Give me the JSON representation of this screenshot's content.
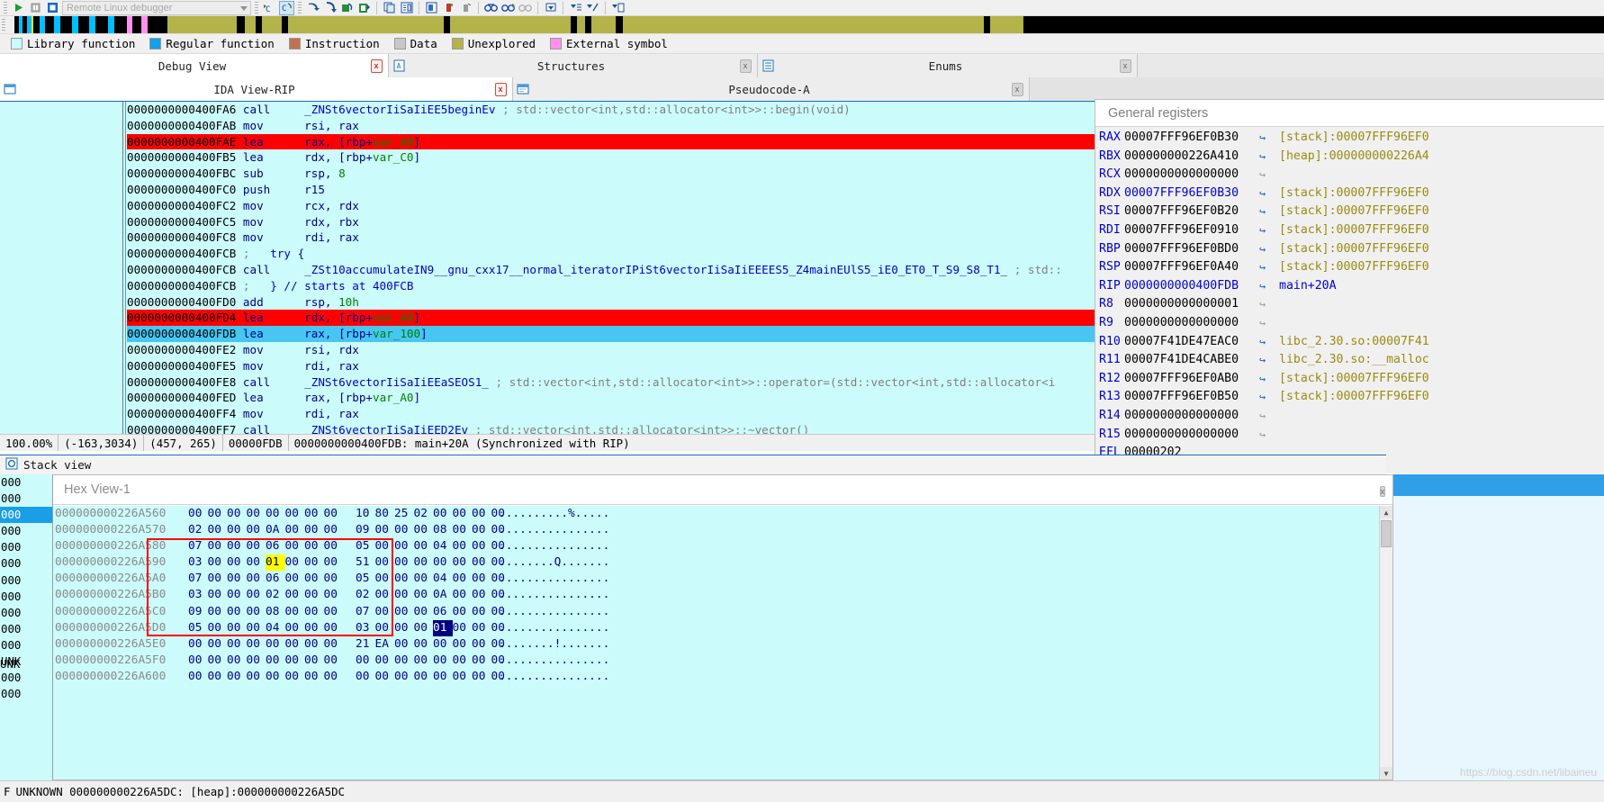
{
  "toolbar": {
    "debugger_combo_value": "Remote Linux debugger",
    "icons": [
      "run-icon",
      "pause-icon",
      "stop-icon",
      "combo-dropdown-icon",
      "step-into-c-icon",
      "step-over-c-icon",
      "run-to-cursor-icon",
      "step-into-icon",
      "step-over-icon",
      "run-until-return-icon",
      "jump-icon",
      "copy-icon",
      "breakpoints-icon",
      "func-list-icon",
      "stack-trace-icon",
      "thread-icon",
      "watch-icon",
      "binocular-icon",
      "binocular-next-icon",
      "binocular-prev-icon",
      "down-arrow-icon",
      "down-list-icon",
      "down-pen-icon",
      "down-code-icon"
    ]
  },
  "legend": {
    "items": [
      {
        "label": "Library function",
        "color": "#c9fdfd"
      },
      {
        "label": "Regular function",
        "color": "#0fa2e8"
      },
      {
        "label": "Instruction",
        "color": "#c0714f"
      },
      {
        "label": "Data",
        "color": "#c8c8c8"
      },
      {
        "label": "Unexplored",
        "color": "#b3b34a"
      },
      {
        "label": "External symbol",
        "color": "#ff90f0"
      }
    ]
  },
  "tabs_row1": [
    {
      "label": "Debug View",
      "icon": "",
      "active": true,
      "close": "x",
      "close_style": "red"
    },
    {
      "label": "Structures",
      "icon": "struct-icon",
      "active": false,
      "close": "x",
      "close_style": "grey"
    },
    {
      "label": "Enums",
      "icon": "enums-icon",
      "active": false,
      "close": "x",
      "close_style": "grey"
    }
  ],
  "tabs_row2": [
    {
      "label": "IDA View-RIP",
      "icon": "view-icon",
      "active": true,
      "close": "x",
      "close_style": "red"
    },
    {
      "label": "Pseudocode-A",
      "icon": "pseudo-icon",
      "active": false,
      "close": "x",
      "close_style": "grey"
    }
  ],
  "disassembly": {
    "lines": [
      {
        "addr": "0000000000400FA6",
        "mnem": "call",
        "op": "_ZNSt6vectorIiSaIiEE5beginEv",
        "opclass": "name",
        "cmt": "; std::vector<int,std::allocator<int>>::begin(void)",
        "hl": "none"
      },
      {
        "addr": "0000000000400FAB",
        "mnem": "mov",
        "op": "rsi, rax",
        "opclass": "op",
        "cmt": "",
        "hl": "none"
      },
      {
        "addr": "0000000000400FAE",
        "mnem": "lea",
        "op": "rax, [rbp+var_A0]",
        "opclass": "var",
        "cmt": "",
        "hl": "red"
      },
      {
        "addr": "0000000000400FB5",
        "mnem": "lea",
        "op": "rdx, [rbp+var_C0]",
        "opclass": "var",
        "cmt": "",
        "hl": "none"
      },
      {
        "addr": "0000000000400FBC",
        "mnem": "sub",
        "op": "rsp, 8",
        "opclass": "num",
        "cmt": "",
        "hl": "none"
      },
      {
        "addr": "0000000000400FC0",
        "mnem": "push",
        "op": "r15",
        "opclass": "op",
        "cmt": "",
        "hl": "none"
      },
      {
        "addr": "0000000000400FC2",
        "mnem": "mov",
        "op": "rcx, rdx",
        "opclass": "op",
        "cmt": "",
        "hl": "none"
      },
      {
        "addr": "0000000000400FC5",
        "mnem": "mov",
        "op": "rdx, rbx",
        "opclass": "op",
        "cmt": "",
        "hl": "none"
      },
      {
        "addr": "0000000000400FC8",
        "mnem": "mov",
        "op": "rdi, rax",
        "opclass": "op",
        "cmt": "",
        "hl": "none"
      },
      {
        "addr": "0000000000400FCB",
        "mnem": ";",
        "op": "try {",
        "opclass": "trycmt",
        "cmt": "",
        "hl": "none"
      },
      {
        "addr": "0000000000400FCB",
        "mnem": "call",
        "op": "_ZSt10accumulateIN9__gnu_cxx17__normal_iteratorIPiSt6vectorIiSaIiEEEES5_Z4mainEUlS5_iE0_ET0_T_S9_S8_T1_",
        "opclass": "name",
        "cmt": "; std::",
        "hl": "none"
      },
      {
        "addr": "0000000000400FCB",
        "mnem": ";",
        "op": "} // starts at 400FCB",
        "opclass": "trycmt",
        "cmt": "",
        "hl": "none"
      },
      {
        "addr": "0000000000400FD0",
        "mnem": "add",
        "op": "rsp, 10h",
        "opclass": "num",
        "cmt": "",
        "hl": "none"
      },
      {
        "addr": "0000000000400FD4",
        "mnem": "lea",
        "op": "rdx, [rbp+var_A0]",
        "opclass": "var",
        "cmt": "",
        "hl": "red"
      },
      {
        "addr": "0000000000400FDB",
        "mnem": "lea",
        "op": "rax, [rbp+var_100]",
        "opclass": "var",
        "cmt": "",
        "hl": "blue"
      },
      {
        "addr": "0000000000400FE2",
        "mnem": "mov",
        "op": "rsi, rdx",
        "opclass": "op",
        "cmt": "",
        "hl": "none"
      },
      {
        "addr": "0000000000400FE5",
        "mnem": "mov",
        "op": "rdi, rax",
        "opclass": "op",
        "cmt": "",
        "hl": "none"
      },
      {
        "addr": "0000000000400FE8",
        "mnem": "call",
        "op": "_ZNSt6vectorIiSaIiEEaSEOS1_",
        "opclass": "name",
        "cmt": "; std::vector<int,std::allocator<int>>::operator=(std::vector<int,std::allocator<i",
        "hl": "none"
      },
      {
        "addr": "0000000000400FED",
        "mnem": "lea",
        "op": "rax, [rbp+var_A0]",
        "opclass": "var",
        "cmt": "",
        "hl": "none"
      },
      {
        "addr": "0000000000400FF4",
        "mnem": "mov",
        "op": "rdi, rax",
        "opclass": "op",
        "cmt": "",
        "hl": "none"
      },
      {
        "addr": "0000000000400FF7",
        "mnem": "call",
        "op": "_ZNSt6vectorIiSaIiEED2Ev",
        "opclass": "name",
        "cmt": "; std::vector<int,std::allocator<int>>::~vector()",
        "hl": "none"
      }
    ],
    "status": [
      "100.00%",
      "(-163,3034)",
      "(457, 265)",
      "00000FDB",
      "0000000000400FDB: main+20A (Synchronized with RIP)"
    ]
  },
  "registers": {
    "title": "General registers",
    "rows": [
      {
        "name": "RAX",
        "value": "00007FFF96EF0B30",
        "value_blue": false,
        "arrow": "active",
        "comment": "[stack]:00007FFF96EF0",
        "comment_blue": false
      },
      {
        "name": "RBX",
        "value": "000000000226A410",
        "value_blue": false,
        "arrow": "active",
        "comment": "[heap]:000000000226A4",
        "comment_blue": false
      },
      {
        "name": "RCX",
        "value": "0000000000000000",
        "value_blue": false,
        "arrow": "grey",
        "comment": "",
        "comment_blue": false
      },
      {
        "name": "RDX",
        "value": "00007FFF96EF0B30",
        "value_blue": true,
        "arrow": "active",
        "comment": "[stack]:00007FFF96EF0",
        "comment_blue": false
      },
      {
        "name": "RSI",
        "value": "00007FFF96EF0B20",
        "value_blue": false,
        "arrow": "active",
        "comment": "[stack]:00007FFF96EF0",
        "comment_blue": false
      },
      {
        "name": "RDI",
        "value": "00007FFF96EF0910",
        "value_blue": false,
        "arrow": "active",
        "comment": "[stack]:00007FFF96EF0",
        "comment_blue": false
      },
      {
        "name": "RBP",
        "value": "00007FFF96EF0BD0",
        "value_blue": false,
        "arrow": "active",
        "comment": "[stack]:00007FFF96EF0",
        "comment_blue": false
      },
      {
        "name": "RSP",
        "value": "00007FFF96EF0A40",
        "value_blue": false,
        "arrow": "active",
        "comment": "[stack]:00007FFF96EF0",
        "comment_blue": false
      },
      {
        "name": "RIP",
        "value": "0000000000400FDB",
        "value_blue": true,
        "arrow": "active",
        "comment": "main+20A",
        "comment_blue": true
      },
      {
        "name": "R8",
        "value": "0000000000000001",
        "value_blue": false,
        "arrow": "grey",
        "comment": "",
        "comment_blue": false
      },
      {
        "name": "R9",
        "value": "0000000000000000",
        "value_blue": false,
        "arrow": "grey",
        "comment": "",
        "comment_blue": false
      },
      {
        "name": "R10",
        "value": "00007F41DE47EAC0",
        "value_blue": false,
        "arrow": "active",
        "comment": "libc_2.30.so:00007F41",
        "comment_blue": false
      },
      {
        "name": "R11",
        "value": "00007F41DE4CABE0",
        "value_blue": false,
        "arrow": "active",
        "comment": "libc_2.30.so:__malloc",
        "comment_blue": false
      },
      {
        "name": "R12",
        "value": "00007FFF96EF0AB0",
        "value_blue": false,
        "arrow": "active",
        "comment": "[stack]:00007FFF96EF0",
        "comment_blue": false
      },
      {
        "name": "R13",
        "value": "00007FFF96EF0B50",
        "value_blue": false,
        "arrow": "active",
        "comment": "[stack]:00007FFF96EF0",
        "comment_blue": false
      },
      {
        "name": "R14",
        "value": "0000000000000000",
        "value_blue": false,
        "arrow": "grey",
        "comment": "",
        "comment_blue": false
      },
      {
        "name": "R15",
        "value": "0000000000000000",
        "value_blue": false,
        "arrow": "grey",
        "comment": "",
        "comment_blue": false
      },
      {
        "name": "EFL",
        "value": "00000202",
        "value_blue": false,
        "arrow": "none",
        "comment": "",
        "comment_blue": false
      }
    ]
  },
  "stack_view": {
    "title": "Stack view",
    "icon": "stack-icon"
  },
  "stack_strip_rows": [
    "000",
    "000",
    "000",
    "000",
    "000",
    "000",
    "000",
    "000",
    "000",
    "000",
    "000",
    "UNK",
    "000",
    "000"
  ],
  "hex_view": {
    "title": "Hex View-1",
    "rows": [
      {
        "addr": "000000000226A560",
        "bytes": [
          "00",
          "00",
          "00",
          "00",
          "00",
          "00",
          "00",
          "00",
          "10",
          "80",
          "25",
          "02",
          "00",
          "00",
          "00",
          "00"
        ],
        "ascii": "..........%....."
      },
      {
        "addr": "000000000226A570",
        "bytes": [
          "02",
          "00",
          "00",
          "00",
          "0A",
          "00",
          "00",
          "00",
          "09",
          "00",
          "00",
          "00",
          "08",
          "00",
          "00",
          "00"
        ],
        "ascii": "................"
      },
      {
        "addr": "000000000226A580",
        "bytes": [
          "07",
          "00",
          "00",
          "00",
          "06",
          "00",
          "00",
          "00",
          "05",
          "00",
          "00",
          "00",
          "04",
          "00",
          "00",
          "00"
        ],
        "ascii": "................"
      },
      {
        "addr": "000000000226A590",
        "bytes": [
          "03",
          "00",
          "00",
          "00",
          "01",
          "00",
          "00",
          "00",
          "51",
          "00",
          "00",
          "00",
          "00",
          "00",
          "00",
          "00"
        ],
        "ascii": "........Q......."
      },
      {
        "addr": "000000000226A5A0",
        "bytes": [
          "07",
          "00",
          "00",
          "00",
          "06",
          "00",
          "00",
          "00",
          "05",
          "00",
          "00",
          "00",
          "04",
          "00",
          "00",
          "00"
        ],
        "ascii": "................"
      },
      {
        "addr": "000000000226A5B0",
        "bytes": [
          "03",
          "00",
          "00",
          "00",
          "02",
          "00",
          "00",
          "00",
          "02",
          "00",
          "00",
          "00",
          "0A",
          "00",
          "00",
          "00"
        ],
        "ascii": "................"
      },
      {
        "addr": "000000000226A5C0",
        "bytes": [
          "09",
          "00",
          "00",
          "00",
          "08",
          "00",
          "00",
          "00",
          "07",
          "00",
          "00",
          "00",
          "06",
          "00",
          "00",
          "00"
        ],
        "ascii": "................"
      },
      {
        "addr": "000000000226A5D0",
        "bytes": [
          "05",
          "00",
          "00",
          "00",
          "04",
          "00",
          "00",
          "00",
          "03",
          "00",
          "00",
          "00",
          "01",
          "00",
          "00",
          "00"
        ],
        "ascii": "................"
      },
      {
        "addr": "000000000226A5E0",
        "bytes": [
          "00",
          "00",
          "00",
          "00",
          "00",
          "00",
          "00",
          "00",
          "21",
          "EA",
          "00",
          "00",
          "00",
          "00",
          "00",
          "00"
        ],
        "ascii": "........!......."
      },
      {
        "addr": "000000000226A5F0",
        "bytes": [
          "00",
          "00",
          "00",
          "00",
          "00",
          "00",
          "00",
          "00",
          "00",
          "00",
          "00",
          "00",
          "00",
          "00",
          "00",
          "00"
        ],
        "ascii": "................"
      },
      {
        "addr": "000000000226A600",
        "bytes": [
          "00",
          "00",
          "00",
          "00",
          "00",
          "00",
          "00",
          "00",
          "00",
          "00",
          "00",
          "00",
          "00",
          "00",
          "00",
          "00"
        ],
        "ascii": "................"
      }
    ],
    "highlight_yellow": {
      "row": 3,
      "byte": 4
    },
    "highlight_navy": {
      "row": 7,
      "byte": 12
    },
    "selection_box_color": "#ff0000",
    "scrollbar": {
      "up": "▲",
      "down": "▼"
    }
  },
  "bottom_status": {
    "flag": "F",
    "text": "UNKNOWN 000000000226A5DC: [heap]:000000000226A5DC"
  },
  "watermark": "https://blog.csdn.net/libaineu",
  "colors": {
    "highlight_current_red": "#fe0000",
    "highlight_current_blue": "#46c6f0",
    "library_function_bg": "#ccfbfb",
    "register_link": "#1a5fcb",
    "comment_yellow": "#9a8a10"
  }
}
